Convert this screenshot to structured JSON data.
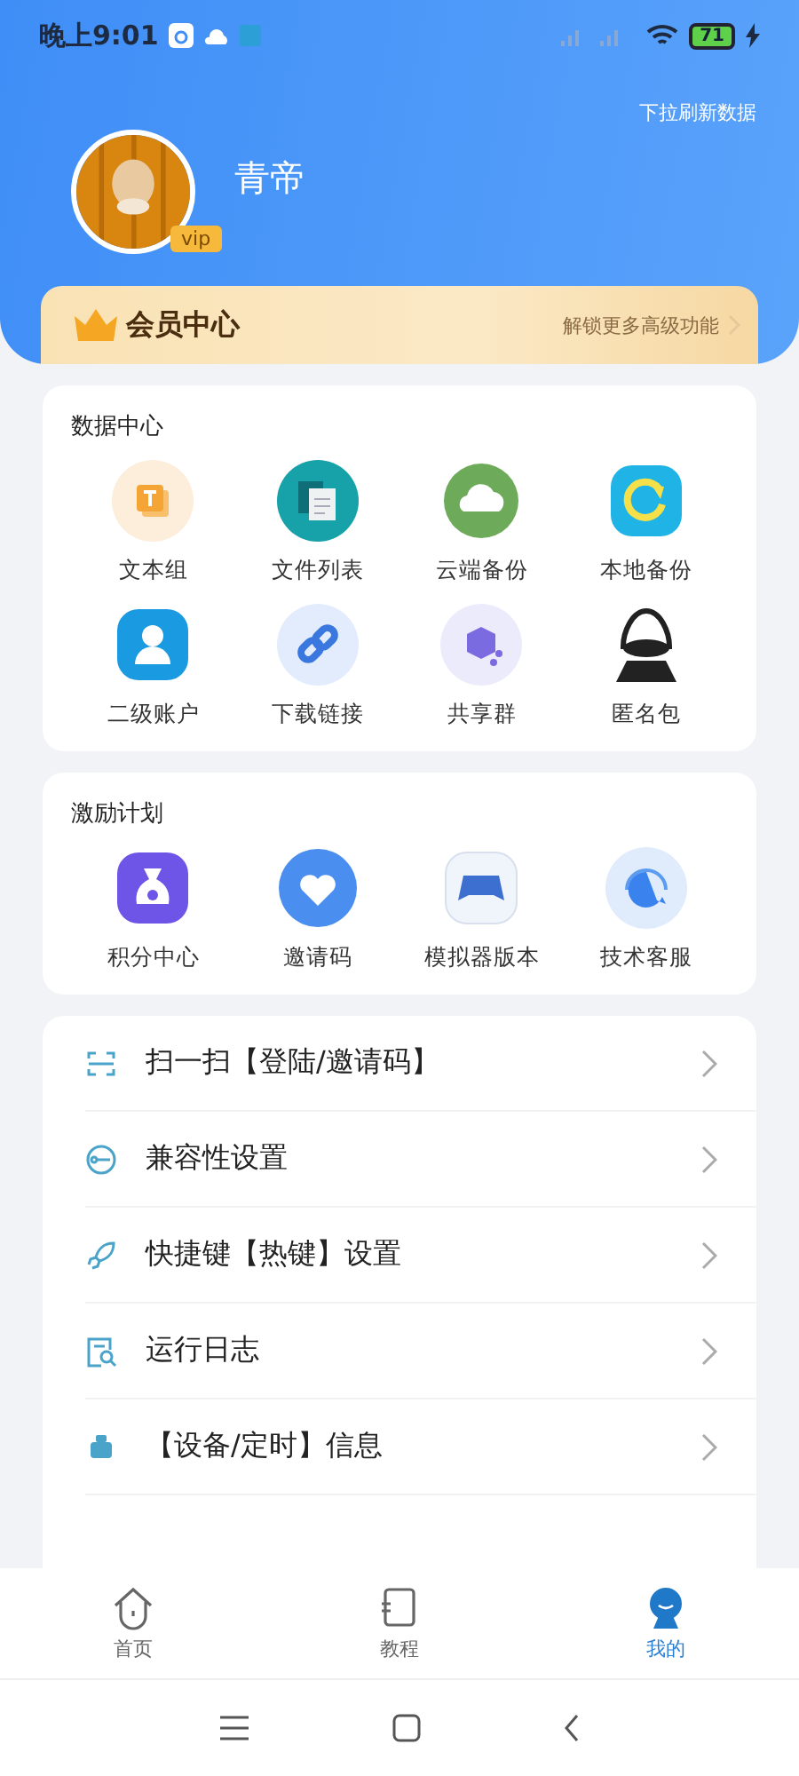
{
  "status_bar": {
    "time": "晚上9:01",
    "battery": "71"
  },
  "header": {
    "pull_hint": "下拉刷新数据",
    "username": "青帝",
    "badge": "vip"
  },
  "vip_card": {
    "title": "会员中心",
    "subtitle": "解锁更多高级功能"
  },
  "sections": [
    {
      "title": "数据中心",
      "items": [
        {
          "label": "文本组"
        },
        {
          "label": "文件列表"
        },
        {
          "label": "云端备份"
        },
        {
          "label": "本地备份"
        },
        {
          "label": "二级账户"
        },
        {
          "label": "下载链接"
        },
        {
          "label": "共享群"
        },
        {
          "label": "匿名包"
        }
      ]
    },
    {
      "title": "激励计划",
      "items": [
        {
          "label": "积分中心"
        },
        {
          "label": "邀请码"
        },
        {
          "label": "模拟器版本"
        },
        {
          "label": "技术客服"
        }
      ]
    }
  ],
  "menu": [
    {
      "label": "扫一扫【登陆/邀请码】"
    },
    {
      "label": "兼容性设置"
    },
    {
      "label": "快捷键【热键】设置"
    },
    {
      "label": "运行日志"
    },
    {
      "label": "【设备/定时】信息"
    }
  ],
  "tab_bar": [
    {
      "label": "首页",
      "selected": false
    },
    {
      "label": "教程",
      "selected": false
    },
    {
      "label": "我的",
      "selected": true
    }
  ]
}
